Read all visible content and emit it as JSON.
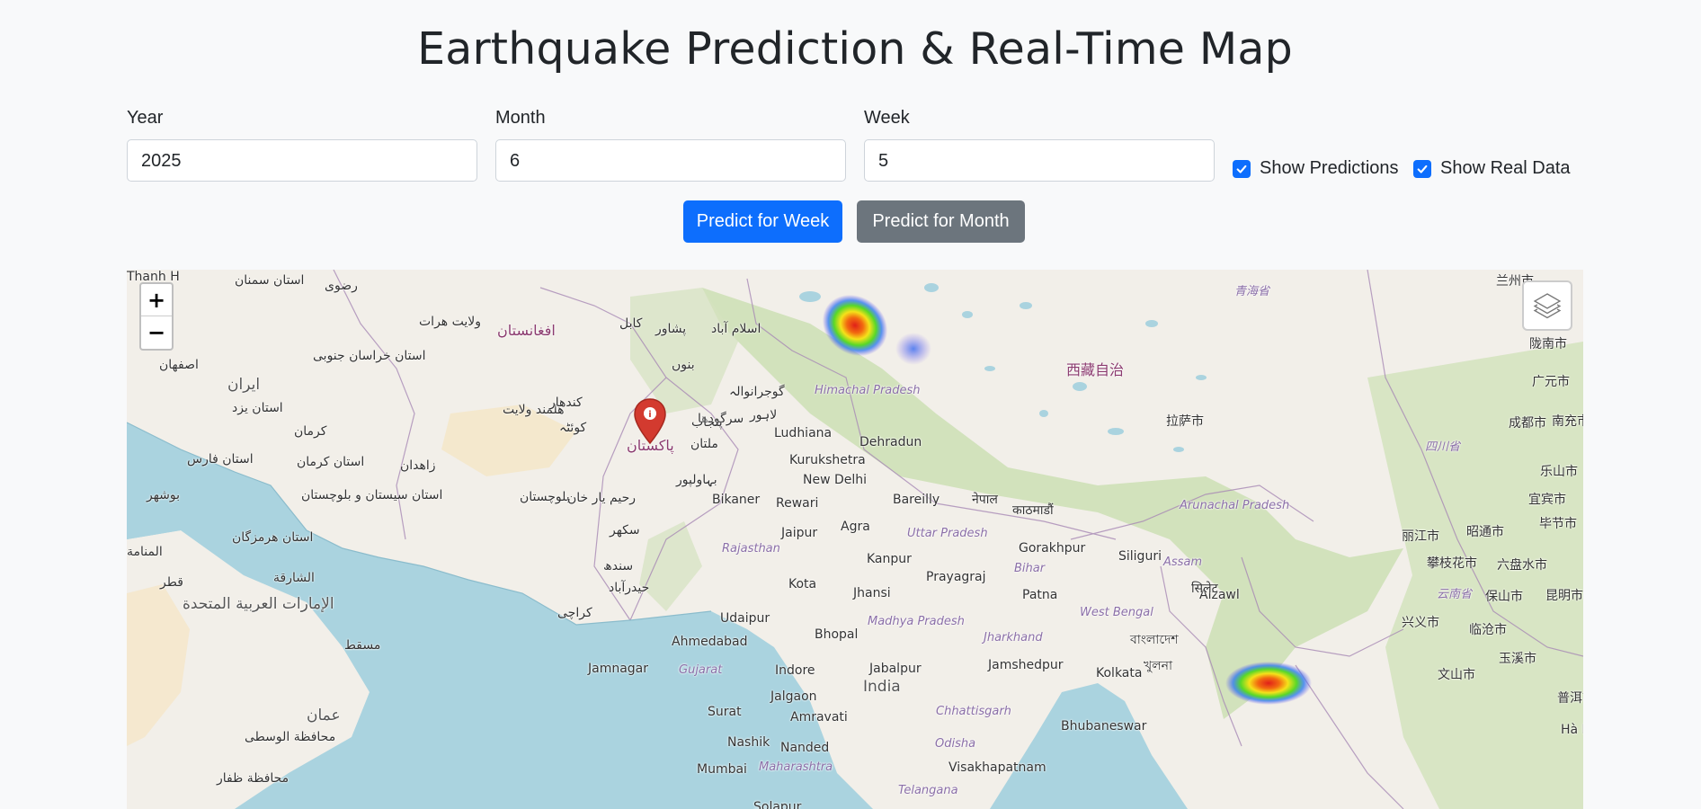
{
  "page": {
    "title": "Earthquake Prediction & Real-Time Map"
  },
  "form": {
    "year": {
      "label": "Year",
      "value": "2025"
    },
    "month": {
      "label": "Month",
      "value": "6"
    },
    "week": {
      "label": "Week",
      "value": "5"
    },
    "show_predictions": {
      "label": "Show Predictions",
      "checked": true
    },
    "show_real_data": {
      "label": "Show Real Data",
      "checked": true
    },
    "predict_week_label": "Predict for Week",
    "predict_month_label": "Predict for Month"
  },
  "map": {
    "zoom_in": "+",
    "zoom_out": "−",
    "labels": [
      "استان سمنان",
      "رضوی",
      "ولایت هرات",
      "افغانستان",
      "کابل",
      "پشاور",
      "اسلام آباد",
      "بنوں",
      "اصفهان",
      "ایران",
      "استان خراسان جنوبی",
      "هلمند ولایت",
      "کندهار",
      "کوئٹہ",
      "پاکستان",
      "ملتان",
      "سرگودھا",
      "گوجرانوالہ",
      "لاہور",
      "پنجاب",
      "استان یزد",
      "کرمان",
      "استان کرمان",
      "زاهدان",
      "استان فارس",
      "استان سیستان و بلوچستان",
      "بلوچستان",
      "رحیم یار خان",
      "بہاولپور",
      "بوشهر",
      "سکھر",
      "استان هرمزگان",
      "المنامة",
      "قطر",
      "الشارقة",
      "الإمارات العربية المتحدة",
      "سندھ",
      "حیدرآباد",
      "کراچی",
      "مسقط",
      "عمان",
      "محافظة الوسطى",
      "محافظة ظفار",
      "Ludhiana",
      "Himachal Pradesh",
      "Dehradun",
      "Kurukshetra",
      "New Delhi",
      "Bikaner",
      "Rewari",
      "Bareilly",
      "Jaipur",
      "Agra",
      "Uttar Pradesh",
      "Rajasthan",
      "Kanpur",
      "Prayagraj",
      "Gorakhpur",
      "Siliguri",
      "Kota",
      "Jhansi",
      "Patna",
      "Bihar",
      "Udaipur",
      "Ahmedabad",
      "Bhopal",
      "Madhya Pradesh",
      "Indore",
      "Jabalpur",
      "Jamshedpur",
      "Jharkhand",
      "West Bengal",
      "Kolkata",
      "Gujarat",
      "Jamnagar",
      "Jalgaon",
      "India",
      "Amravati",
      "Chhattisgarh",
      "Surat",
      "Nashik",
      "Nanded",
      "Odisha",
      "Bhubaneswar",
      "Mumbai",
      "Maharashtra",
      "Visakhapatnam",
      "Telangana",
      "Solapur",
      "नेपाल",
      "काठमाडौं",
      "Assam",
      "Aizawl",
      "सिलेट",
      "বাংলাদেশ",
      "খুলনা",
      "Arunachal Pradesh",
      "西藏自治",
      "拉萨市",
      "青海省",
      "兰州市",
      "陇南市",
      "广元市",
      "成都市",
      "南充市",
      "四川省",
      "乐山市",
      "宜宾市",
      "毕节市",
      "丽江市",
      "昭通市",
      "攀枝花市",
      "六盘水市",
      "云南省",
      "保山市",
      "昆明市",
      "兴义市",
      "临沧市",
      "玉溪市",
      "文山市",
      "普洱市",
      "Hà Nội",
      "Thanh H"
    ]
  },
  "colors": {
    "primary": "#0d6efd",
    "secondary": "#6c757d",
    "marker": "#d33a2f",
    "water": "#aad3df",
    "land": "#f2efe9"
  }
}
